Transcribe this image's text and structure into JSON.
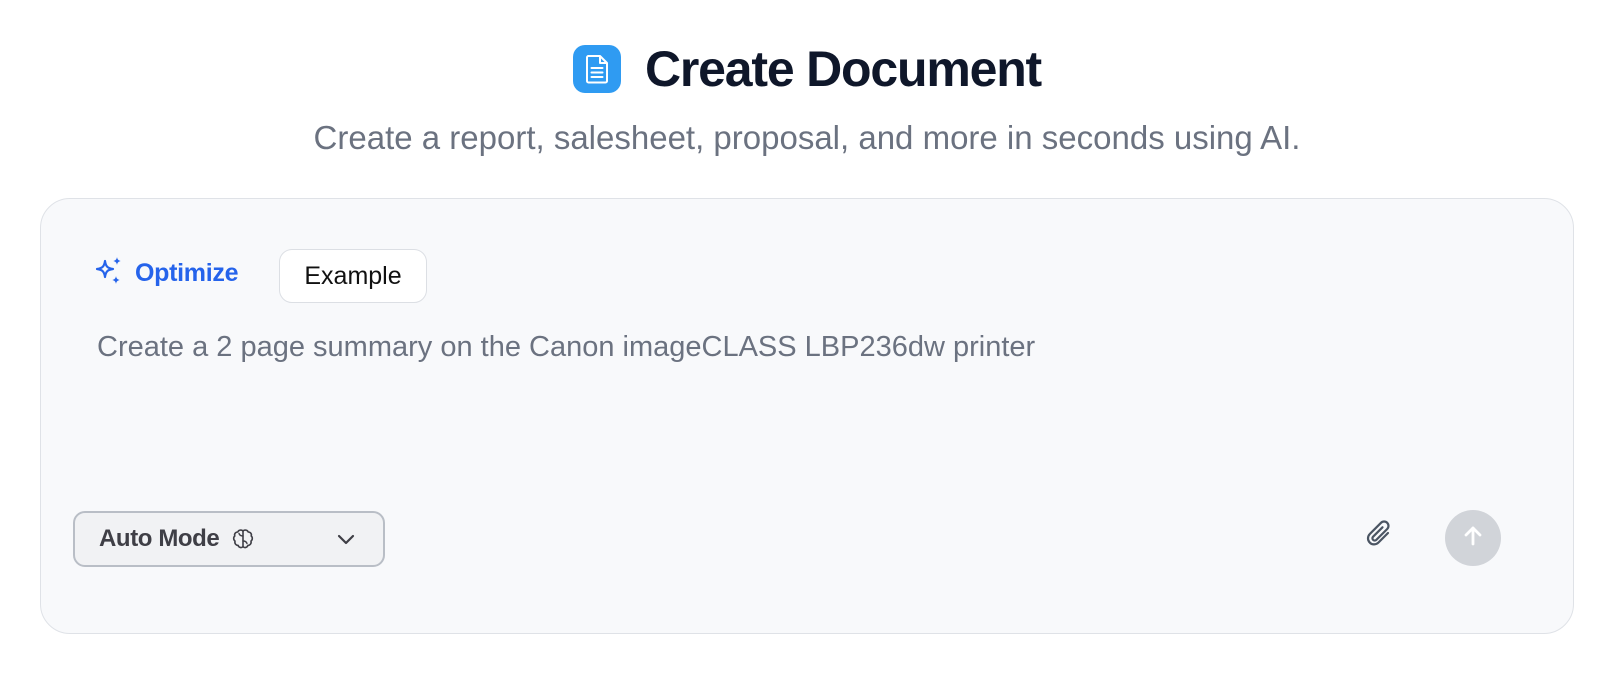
{
  "header": {
    "title": "Create Document",
    "subtitle": "Create a report, salesheet, proposal, and more in seconds using AI.",
    "icon": "document-icon",
    "icon_color": "#2f9bf2"
  },
  "composer": {
    "optimize_label": "Optimize",
    "example_label": "Example",
    "prompt_value": "Create a 2 page summary on the Canon imageCLASS LBP236dw printer",
    "mode_label": "Auto Mode",
    "mode_icon": "brain-icon",
    "dropdown_icon": "chevron-down-icon",
    "attach_icon": "paperclip-icon",
    "send_icon": "arrow-up-icon",
    "accent_color": "#2563eb",
    "send_disabled_color": "#d1d4d9"
  }
}
